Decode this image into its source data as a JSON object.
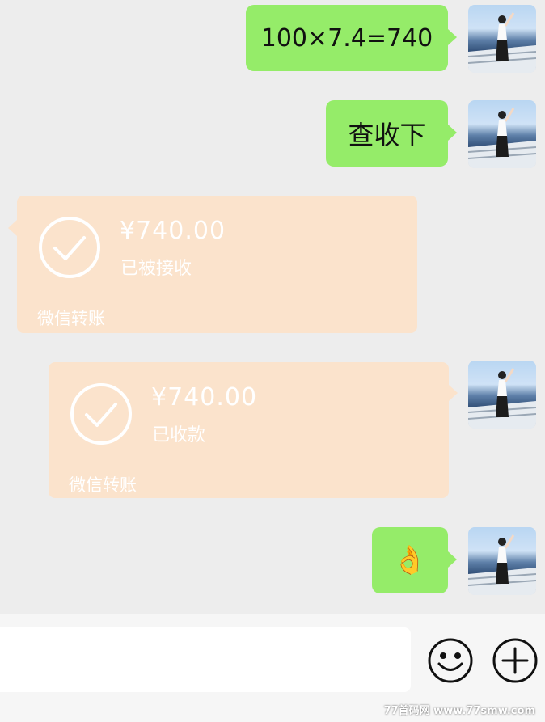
{
  "messages": {
    "m1": {
      "text": "100×7.4=740"
    },
    "m2": {
      "text": "查收下"
    },
    "transfer_received": {
      "amount": "¥740.00",
      "status": "已被接收",
      "footer": "微信转账"
    },
    "transfer_sent": {
      "amount": "¥740.00",
      "status": "已收款",
      "footer": "微信转账"
    },
    "m5": {
      "emoji": "👌"
    }
  },
  "input_bar": {
    "emoji_icon": "smiley-face-icon",
    "more_icon": "plus-circle-icon"
  },
  "watermark": "77首码网  www.77smw.com",
  "colors": {
    "green_bubble": "#95ec69",
    "transfer_bubble": "#fbe3cc",
    "background": "#ededed"
  }
}
